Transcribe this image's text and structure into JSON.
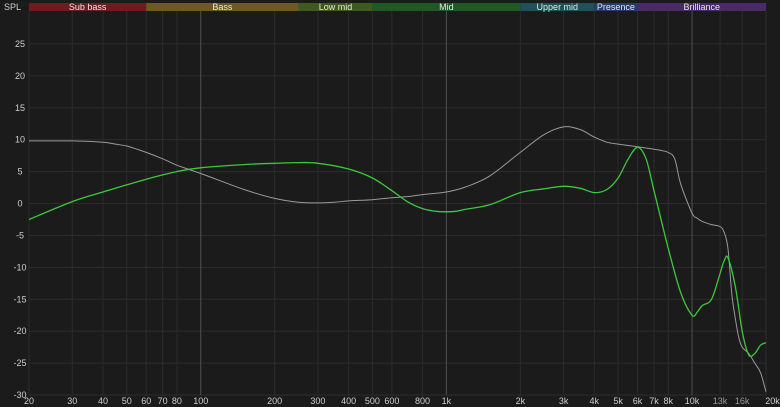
{
  "chart_data": {
    "type": "line",
    "ylabel": "SPL",
    "x_scale": "log",
    "xlim": [
      20,
      20000
    ],
    "ylim": [
      -30,
      30
    ],
    "grid": true,
    "y_ticks": [
      "25",
      "20",
      "15",
      "10",
      "5",
      "0",
      "-5",
      "-10",
      "-15",
      "-20",
      "-25",
      "-30"
    ],
    "y_tick_values": [
      25,
      20,
      15,
      10,
      5,
      0,
      -5,
      -10,
      -15,
      -20,
      -25,
      -30
    ],
    "x_ticks": [
      {
        "label": "20",
        "value": 20
      },
      {
        "label": "30",
        "value": 30
      },
      {
        "label": "40",
        "value": 40
      },
      {
        "label": "50",
        "value": 50
      },
      {
        "label": "60",
        "value": 60
      },
      {
        "label": "70",
        "value": 70
      },
      {
        "label": "80",
        "value": 80
      },
      {
        "label": "100",
        "value": 100
      },
      {
        "label": "200",
        "value": 200
      },
      {
        "label": "300",
        "value": 300
      },
      {
        "label": "400",
        "value": 400
      },
      {
        "label": "500",
        "value": 500
      },
      {
        "label": "600",
        "value": 600
      },
      {
        "label": "800",
        "value": 800
      },
      {
        "label": "1k",
        "value": 1000
      },
      {
        "label": "2k",
        "value": 2000
      },
      {
        "label": "3k",
        "value": 3000
      },
      {
        "label": "4k",
        "value": 4000
      },
      {
        "label": "5k",
        "value": 5000
      },
      {
        "label": "6k",
        "value": 6000
      },
      {
        "label": "7k",
        "value": 7000
      },
      {
        "label": "8k",
        "value": 8000
      },
      {
        "label": "10k",
        "value": 10000
      },
      {
        "label": "13k",
        "value": 13000
      },
      {
        "label": "16k",
        "value": 16000
      },
      {
        "label": "20kHz",
        "value": 20000
      }
    ],
    "dim_x_ticks": [
      "13k",
      "16k"
    ],
    "major_x_lines": [
      100,
      1000,
      10000
    ],
    "bands": [
      {
        "label": "Sub bass",
        "from": 20,
        "to": 60,
        "color": "#6e1c20"
      },
      {
        "label": "Bass",
        "from": 60,
        "to": 250,
        "color": "#6e5a1e"
      },
      {
        "label": "Low mid",
        "from": 250,
        "to": 500,
        "color": "#3e5a1c"
      },
      {
        "label": "Mid",
        "from": 500,
        "to": 2000,
        "color": "#1e5a24"
      },
      {
        "label": "Upper mid",
        "from": 2000,
        "to": 4000,
        "color": "#1e5258"
      },
      {
        "label": "Presence",
        "from": 4000,
        "to": 6000,
        "color": "#243c6a"
      },
      {
        "label": "Brilliance",
        "from": 6000,
        "to": 20000,
        "color": "#4a2a66"
      }
    ],
    "series": [
      {
        "color": "#9a9a9a",
        "x": [
          20,
          30,
          40,
          45,
          50,
          55,
          60,
          70,
          80,
          100,
          150,
          200,
          250,
          300,
          350,
          400,
          500,
          600,
          700,
          800,
          1000,
          1200,
          1500,
          2000,
          2500,
          3000,
          3500,
          4000,
          4500,
          5000,
          6000,
          7000,
          7500,
          8000,
          8500,
          9000,
          10000,
          10500,
          11000,
          12000,
          13000,
          13500,
          14000,
          14500,
          15000,
          15500,
          16000,
          17000,
          18000,
          19000,
          20000
        ],
        "y": [
          9.8,
          9.8,
          9.6,
          9.3,
          9.0,
          8.5,
          8.0,
          7.0,
          6.0,
          4.7,
          2.2,
          0.8,
          0.2,
          0.1,
          0.2,
          0.4,
          0.6,
          0.9,
          1.1,
          1.4,
          1.8,
          2.6,
          4.3,
          8.0,
          10.8,
          12.0,
          11.6,
          10.4,
          9.6,
          9.3,
          8.9,
          8.5,
          8.3,
          8.0,
          7.0,
          3.0,
          -1.5,
          -2.3,
          -2.8,
          -3.3,
          -3.6,
          -4.5,
          -7.0,
          -14.0,
          -18.0,
          -21.0,
          -22.5,
          -23.5,
          -25.0,
          -26.5,
          -29.5
        ]
      },
      {
        "color": "#3cc83c",
        "x": [
          20,
          30,
          40,
          60,
          80,
          100,
          150,
          200,
          250,
          300,
          400,
          500,
          600,
          700,
          800,
          900,
          1000,
          1100,
          1200,
          1500,
          2000,
          2500,
          3000,
          3500,
          4000,
          4500,
          5000,
          5500,
          6000,
          6500,
          7000,
          8000,
          9000,
          10000,
          10500,
          11000,
          12000,
          13000,
          13500,
          14000,
          15000,
          16000,
          17000,
          18000,
          19000,
          20000
        ],
        "y": [
          -2.5,
          0.3,
          1.8,
          3.8,
          5.0,
          5.6,
          6.1,
          6.3,
          6.4,
          6.3,
          5.4,
          4.0,
          2.0,
          0.2,
          -0.8,
          -1.2,
          -1.3,
          -1.2,
          -0.9,
          -0.2,
          1.7,
          2.3,
          2.7,
          2.4,
          1.7,
          2.2,
          4.0,
          7.0,
          8.8,
          7.0,
          2.0,
          -7.0,
          -14.0,
          -17.5,
          -17.0,
          -16.0,
          -15.0,
          -11.0,
          -9.0,
          -8.5,
          -13.0,
          -20.0,
          -23.7,
          -23.5,
          -22.2,
          -21.8
        ]
      }
    ]
  }
}
